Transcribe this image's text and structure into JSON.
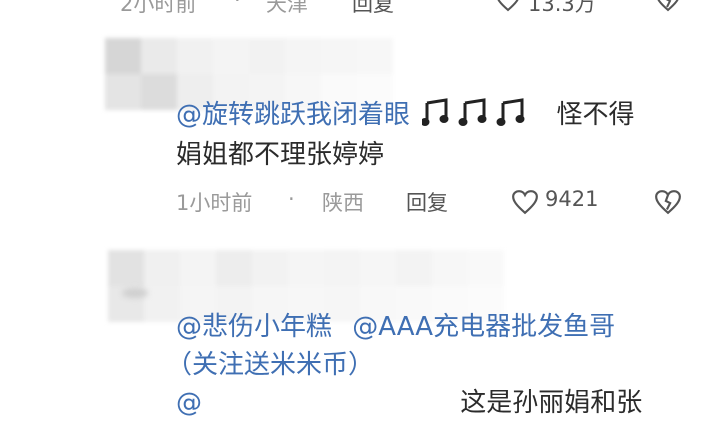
{
  "comment_prev": {
    "time": "2小时前",
    "location": "天津",
    "reply_label": "回复",
    "likes": "13.3万"
  },
  "comment_1": {
    "mention": "@旋转跳跃我闭着眼",
    "notes_icons": "music-notes-icon",
    "text_line1_tail": "怪不得",
    "text_line2": "娟姐都不理张婷婷",
    "time": "1小时前",
    "location": "陕西",
    "reply_label": "回复",
    "likes": "9421"
  },
  "comment_2": {
    "mention1": "@悲伤小年糕",
    "mention2": "@AAA充电器批发鱼哥",
    "mention2_tail": "（关注送米米币）",
    "line3_prefix": "@",
    "line3_tail": "这是孙丽娟和张"
  },
  "colors": {
    "mention": "#3f6fb3",
    "meta": "#9a9a9a",
    "text": "#2b2b2b"
  }
}
